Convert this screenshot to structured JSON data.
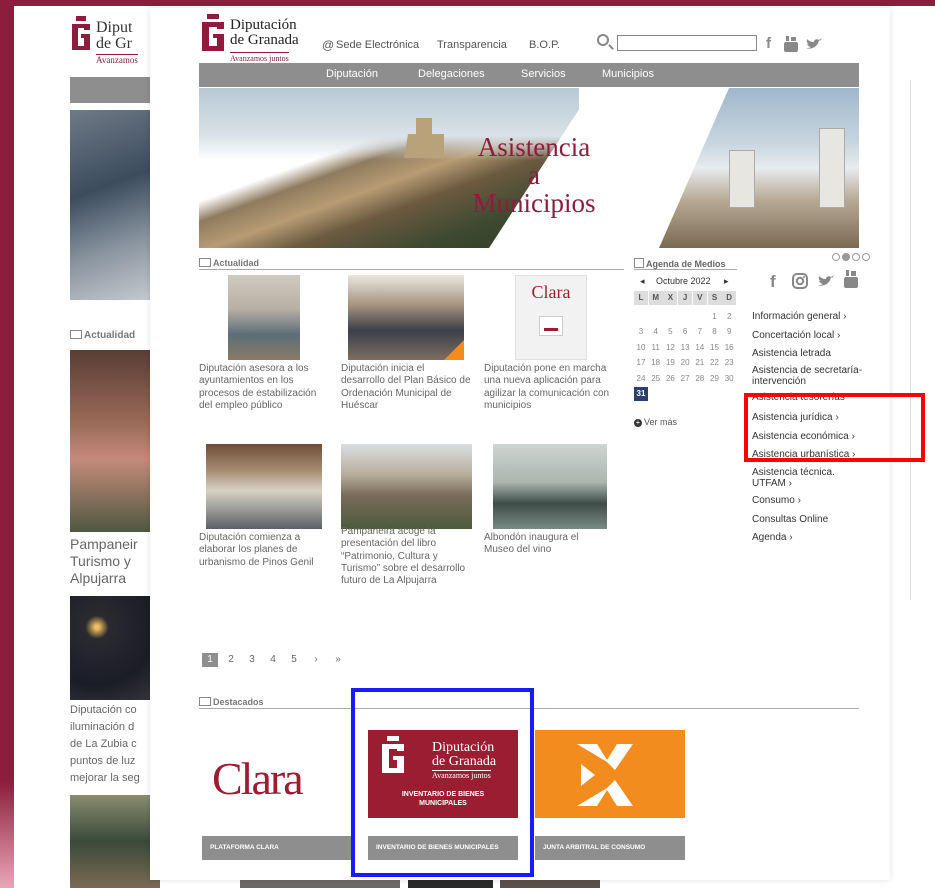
{
  "background_page": {
    "logo_line1": "Diput",
    "logo_line2": "de Gr",
    "logo_tag": "Avanzamos",
    "section_title": "Actualidad",
    "headline": "Pampaneir\nTurismo y\nAlpujarra",
    "text": "Diputación co\niluminación d\nde La Zubia c\npuntos de luz\nmejorar la seg"
  },
  "header": {
    "logo_line1": "Diputación",
    "logo_line2": "de Granada",
    "logo_tag": "Avanzamos juntos",
    "links": [
      "Sede Electrónica",
      "Transparencia",
      "B.O.P."
    ],
    "search_value": "",
    "social_icons": [
      "facebook-icon",
      "youtube-icon",
      "twitter-icon"
    ]
  },
  "nav": {
    "items": [
      "Diputación",
      "Delegaciones",
      "Servicios",
      "Municipios"
    ]
  },
  "banner": {
    "title": "Asistencia\na\nMunicipios"
  },
  "actualidad": {
    "title": "Actualidad",
    "news": [
      {
        "caption": "Diputación asesora a los ayuntamientos en los procesos de estabilización del empleo público"
      },
      {
        "caption": "Diputación inicia el desarrollo del Plan Básico de Ordenación Municipal de Huéscar"
      },
      {
        "caption": "Diputación pone en marcha una nueva aplicación para agilizar la comunicación con municipios"
      },
      {
        "caption": "Diputación comienza a elaborar los planes de urbanismo de Pinos Genil"
      },
      {
        "caption": "Pampaneira acoge la presentación del libro “Patrimonio, Cultura y Turismo” sobre el desarrollo futuro de La Alpujarra"
      },
      {
        "caption": "Albondón inaugura el Museo del vino"
      }
    ],
    "clara_thumb_label": "Clara"
  },
  "agenda": {
    "title": "Agenda de Medios",
    "month": "Octubre 2022",
    "day_names": [
      "L",
      "M",
      "X",
      "J",
      "V",
      "S",
      "D"
    ],
    "weeks": [
      [
        "",
        "",
        "",
        "",
        "",
        "1",
        "2"
      ],
      [
        "3",
        "4",
        "5",
        "6",
        "7",
        "8",
        "9"
      ],
      [
        "10",
        "11",
        "12",
        "13",
        "14",
        "15",
        "16"
      ],
      [
        "17",
        "18",
        "19",
        "20",
        "21",
        "22",
        "23"
      ],
      [
        "24",
        "25",
        "26",
        "27",
        "28",
        "29",
        "30"
      ],
      [
        "31",
        "",
        "",
        "",
        "",
        "",
        ""
      ]
    ],
    "today": "31",
    "ver_mas": "Ver más"
  },
  "sidebar": {
    "social_icons": [
      "facebook-icon",
      "instagram-icon",
      "twitter-icon",
      "youtube-icon"
    ],
    "links": [
      "Información general ›",
      "Concertación local ›",
      "Asistencia letrada",
      "Asistencia de secretaría-\nintervención",
      "Asistencia tesorerías",
      "Asistencia jurídica ›",
      "Asistencia económica ›",
      "Asistencia urbanística ›",
      "Asistencia técnica.\nUTFAM ›",
      "Consumo ›",
      "Consultas Online",
      "Agenda ›"
    ]
  },
  "pagination": {
    "pages": [
      "1",
      "2",
      "3",
      "4",
      "5"
    ],
    "current": "1",
    "next": "›",
    "last": "»"
  },
  "destacados": {
    "title": "Destacados",
    "cards": [
      {
        "logo_text": "Clara",
        "label": "PLATAFORMA CLARA"
      },
      {
        "logo_line1": "Diputación",
        "logo_line2": "de Granada",
        "logo_tag": "Avanzamos juntos",
        "subtitle": "INVENTARIO DE BIENES\nMUNICIPALES",
        "label": "INVENTARIO DE BIENES MUNICIPALES"
      },
      {
        "label": "JUNTA ARBITRAL DE CONSUMO"
      }
    ]
  },
  "colors": {
    "brand": "#8c1d3c",
    "nav_gray": "#8e8e8e",
    "highlight_red": "#ff0000",
    "highlight_blue": "#1a1aff",
    "orange": "#f28c1e"
  }
}
